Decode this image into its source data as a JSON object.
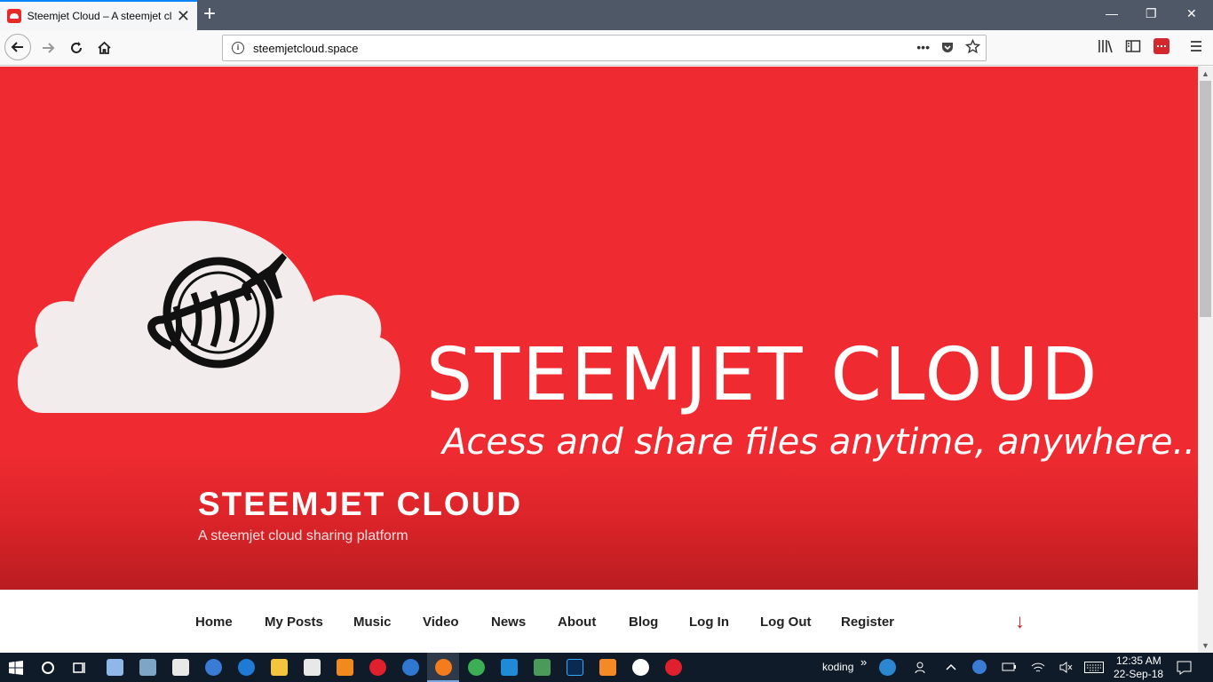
{
  "browser": {
    "tab_title": "Steemjet Cloud – A steemjet cl",
    "tab_close": "✕",
    "new_tab": "+",
    "url": "steemjetcloud.space",
    "window_controls": [
      "—",
      "❐",
      "✕"
    ]
  },
  "hero": {
    "brand_big": "STEEMJET CLOUD",
    "brand_tagline": "Acess and share files anytime, anywhere..",
    "site_title": "STEEMJET CLOUD",
    "site_description": "A steemjet cloud sharing platform"
  },
  "menu": {
    "items": [
      "Home",
      "My Posts",
      "Music",
      "Video",
      "News",
      "About",
      "Blog",
      "Log In",
      "Log Out",
      "Register"
    ],
    "scroll_down": "↓"
  },
  "taskbar": {
    "toolbar_label": "koding",
    "toolbar_chevron": "»",
    "time": "12:35 AM",
    "date": "22-Sep-18"
  },
  "colors": {
    "hero_red": "#ef2b31",
    "hero_dark": "#b91c20",
    "accent_blue": "#0a84ff",
    "taskbar": "#101b29"
  }
}
